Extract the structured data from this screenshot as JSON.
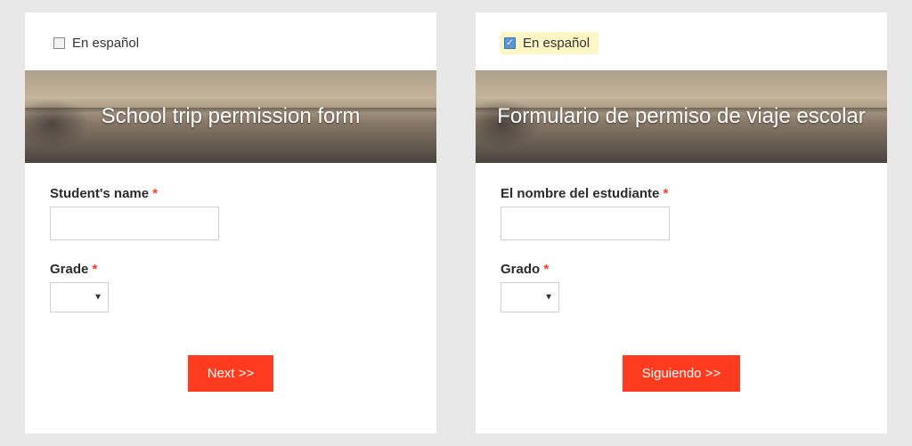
{
  "left": {
    "lang_checkbox": {
      "label": "En español",
      "checked": false,
      "highlighted": false
    },
    "hero_title": "School trip permission form",
    "fields": {
      "name_label": "Student's name",
      "grade_label": "Grade"
    },
    "next_label": "Next >>"
  },
  "right": {
    "lang_checkbox": {
      "label": "En español",
      "checked": true,
      "highlighted": true
    },
    "hero_title": "Formulario de permiso de viaje escolar",
    "fields": {
      "name_label": "El nombre del estudiante",
      "grade_label": "Grado"
    },
    "next_label": "Siguiendo >>"
  },
  "required_marker": "*"
}
